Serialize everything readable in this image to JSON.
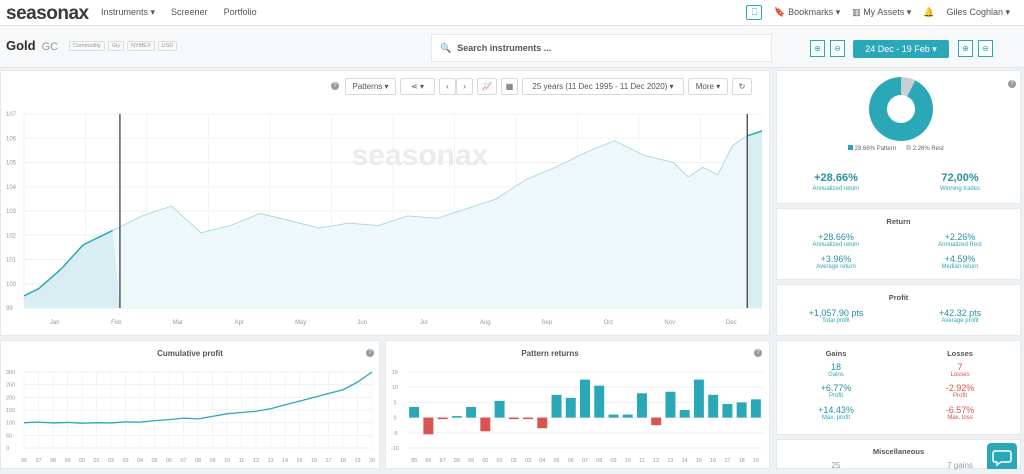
{
  "app": {
    "logo": "seasonax",
    "nav": [
      "Instruments ▾",
      "Screener",
      "Portfolio"
    ],
    "bookmarks": "Bookmarks ▾",
    "my_assets": "My Assets ▾",
    "user": "Giles Coghlan ▾"
  },
  "instrument": {
    "name": "Gold",
    "ticker": "GC",
    "tags": [
      "Commodity",
      "Gly",
      "NYMEX",
      "USD"
    ]
  },
  "search": {
    "placeholder": "Search instruments ..."
  },
  "date_range": "24 Dec - 19 Feb ▾",
  "toolbar": {
    "patterns": "Patterns ▾",
    "period": "25 years (11 Dec 1995 - 11 Dec 2020) ▾",
    "more": "More ▾"
  },
  "colors": {
    "accent": "#2aa8b8",
    "negative": "#d9534f",
    "fill": "#d9eef2"
  },
  "pie": {
    "pattern_label": "28.66% Pattern",
    "rest_label": "2.26% Rest",
    "pattern_pct": 28.66,
    "rest_pct": 2.26
  },
  "summary": {
    "annualized_return": "+28.66%",
    "annualized_return_label": "Annualized return",
    "winning_trades": "72,00%",
    "winning_trades_label": "Winning trades"
  },
  "return": {
    "title": "Return",
    "items": [
      {
        "value": "+28.66%",
        "label": "Annualized return"
      },
      {
        "value": "+2.26%",
        "label": "Annualized Rest"
      },
      {
        "value": "+3.96%",
        "label": "Average return"
      },
      {
        "value": "+4.59%",
        "label": "Median return"
      }
    ]
  },
  "profit": {
    "title": "Profit",
    "items": [
      {
        "value": "+1,057.90 pts",
        "label": "Total profit"
      },
      {
        "value": "+42.32 pts",
        "label": "Average profit"
      }
    ]
  },
  "gains_losses": {
    "gains_title": "Gains",
    "losses_title": "Losses",
    "gains": [
      {
        "value": "18",
        "label": "Gains"
      },
      {
        "value": "+6.77%",
        "label": "Profit"
      },
      {
        "value": "+14.43%",
        "label": "Max. profit"
      }
    ],
    "losses": [
      {
        "value": "7",
        "label": "Losses"
      },
      {
        "value": "-2.92%",
        "label": "Profit"
      },
      {
        "value": "-6.57%",
        "label": "Max. loss"
      }
    ]
  },
  "misc": {
    "title": "Miscellaneous",
    "left": "25",
    "right": "7 gains"
  },
  "chart_data": [
    {
      "type": "line",
      "title": "",
      "y_ticks": [
        "107",
        "106",
        "105",
        "104",
        "103",
        "102",
        "101",
        "100",
        "99"
      ],
      "x_ticks": [
        "Jan",
        "Feb",
        "Mar",
        "Apr",
        "May",
        "Jun",
        "Jul",
        "Aug",
        "Sep",
        "Oct",
        "Nov",
        "Dec"
      ],
      "ylim": [
        99,
        107
      ],
      "watermark": "seasonax",
      "series": [
        {
          "x": [
            0,
            0.02,
            0.05,
            0.08,
            0.12,
            0.16,
            0.2,
            0.24,
            0.28,
            0.32,
            0.36,
            0.4,
            0.44,
            0.48,
            0.52,
            0.56,
            0.6,
            0.64,
            0.68,
            0.72,
            0.76,
            0.8,
            0.84,
            0.88,
            0.9,
            0.92,
            0.94,
            0.96,
            0.98,
            1
          ],
          "y": [
            99.5,
            99.8,
            100.6,
            101.6,
            102.2,
            102.8,
            103.2,
            102.1,
            102.4,
            102.9,
            102.6,
            102.3,
            102.5,
            102.4,
            102.8,
            102.7,
            103.1,
            103.5,
            104.3,
            104.8,
            105.4,
            105.9,
            105.3,
            105.0,
            104.4,
            104.8,
            104.5,
            105.7,
            106.1,
            106.3
          ]
        }
      ],
      "highlight_start_x": 0.13,
      "highlight_end_x": 0.98
    },
    {
      "type": "line",
      "title": "Cumulative profit",
      "y_ticks": [
        "300",
        "250",
        "200",
        "150",
        "100",
        "50",
        "0"
      ],
      "ylim": [
        0,
        300
      ],
      "x_ticks": [
        "96",
        "97",
        "98",
        "99",
        "00",
        "01",
        "02",
        "03",
        "04",
        "05",
        "06",
        "07",
        "08",
        "09",
        "10",
        "11",
        "12",
        "13",
        "14",
        "15",
        "16",
        "17",
        "18",
        "19",
        "20"
      ],
      "series": [
        {
          "values": [
            100,
            102,
            99,
            101,
            98,
            100,
            99,
            103,
            102,
            108,
            112,
            118,
            115,
            125,
            135,
            140,
            145,
            155,
            170,
            185,
            200,
            215,
            230,
            260,
            300
          ]
        }
      ]
    },
    {
      "type": "bar",
      "title": "Pattern returns",
      "y_ticks": [
        "15",
        "10",
        "5",
        "0",
        "-5",
        "-10"
      ],
      "ylim": [
        -10,
        15
      ],
      "categories": [
        "95",
        "96",
        "97",
        "98",
        "99",
        "00",
        "01",
        "02",
        "03",
        "04",
        "05",
        "06",
        "07",
        "08",
        "09",
        "10",
        "11",
        "12",
        "13",
        "14",
        "15",
        "16",
        "17",
        "18",
        "19"
      ],
      "values": [
        3.5,
        -5.5,
        -0.5,
        0.5,
        3.5,
        -4.5,
        5.5,
        -0.5,
        -0.5,
        -3.5,
        7.5,
        6.5,
        12.5,
        10.5,
        1.0,
        1.0,
        8.0,
        -2.5,
        8.5,
        2.5,
        12.5,
        7.5,
        4.5,
        5.0,
        6.0
      ]
    }
  ]
}
